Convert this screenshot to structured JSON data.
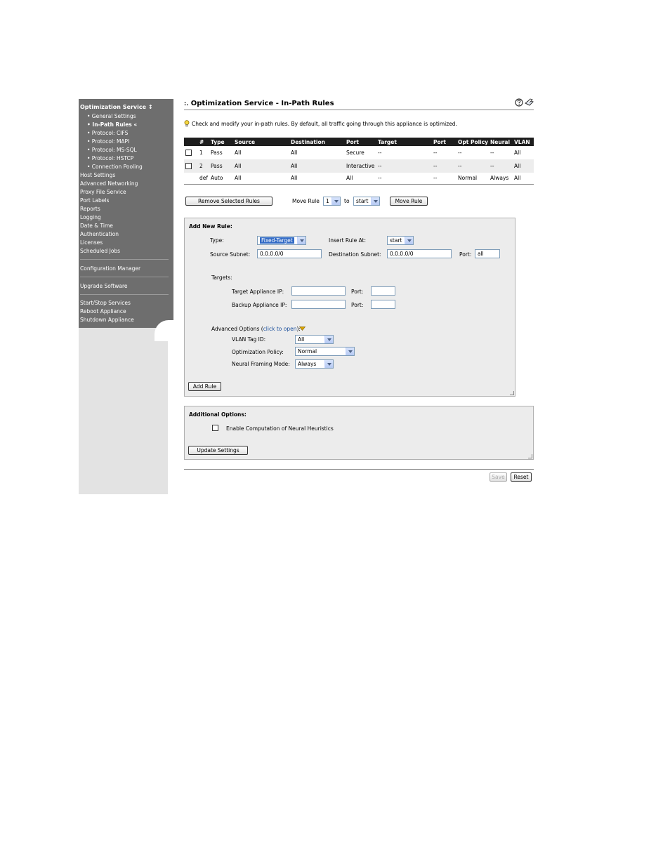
{
  "sidebar": {
    "header": "Optimization Service",
    "header_arrow": "↕",
    "sub_items": [
      {
        "label": "• General Settings",
        "current": false
      },
      {
        "label": "• In-Path Rules «",
        "current": true
      },
      {
        "label": "• Protocol: CIFS",
        "current": false
      },
      {
        "label": "• Protocol: MAPI",
        "current": false
      },
      {
        "label": "• Protocol: MS-SQL",
        "current": false
      },
      {
        "label": "• Protocol: HSTCP",
        "current": false
      },
      {
        "label": "• Connection Pooling",
        "current": false
      }
    ],
    "items": [
      "Host Settings",
      "Advanced Networking",
      "Proxy File Service",
      "Port Labels",
      "Reports",
      "Logging",
      "Date & Time",
      "Authentication",
      "Licenses",
      "Scheduled Jobs"
    ],
    "group2": [
      "Configuration Manager"
    ],
    "group3": [
      "Upgrade Software"
    ],
    "group4": [
      "Start/Stop Services",
      "Reboot Appliance",
      "Shutdown Appliance"
    ]
  },
  "header": {
    "prefix": ":.",
    "title": "Optimization Service - In-Path Rules",
    "hint": "Check and modify your in-path rules. By default, all traffic going through this appliance is optimized.",
    "icons": [
      "help-icon",
      "print-icon"
    ]
  },
  "rules_table": {
    "columns": [
      "#",
      "Type",
      "Source",
      "Destination",
      "Port",
      "Target",
      "Port",
      "Opt Policy",
      "Neural",
      "VLAN"
    ],
    "rows": [
      {
        "num": "1",
        "type": "Pass",
        "source": "All",
        "destination": "All",
        "port": "Secure",
        "target": "--",
        "target_port": "--",
        "opt_policy": "--",
        "neural": "--",
        "vlan": "All",
        "checkbox": true
      },
      {
        "num": "2",
        "type": "Pass",
        "source": "All",
        "destination": "All",
        "port": "Interactive",
        "target": "--",
        "target_port": "--",
        "opt_policy": "--",
        "neural": "--",
        "vlan": "All",
        "checkbox": true
      },
      {
        "num": "def",
        "type": "Auto",
        "source": "All",
        "destination": "All",
        "port": "All",
        "target": "--",
        "target_port": "--",
        "opt_policy": "Normal",
        "neural": "Always",
        "vlan": "All",
        "checkbox": false
      }
    ]
  },
  "controls": {
    "remove_button": "Remove Selected Rules",
    "move_rule_label": "Move Rule",
    "move_rule_value": "1",
    "to_label": "to",
    "to_value": "start",
    "move_button": "Move Rule"
  },
  "add_rule": {
    "heading": "Add New Rule:",
    "type_label": "Type:",
    "type_value": "Fixed-Target",
    "insert_label": "Insert Rule At:",
    "insert_value": "start",
    "source_label": "Source Subnet:",
    "source_value": "0.0.0.0/0",
    "dest_label": "Destination Subnet:",
    "dest_value": "0.0.0.0/0",
    "port_label": "Port:",
    "port_value": "all",
    "targets_label": "Targets:",
    "target_ip_label": "Target Appliance IP:",
    "target_port_label": "Port:",
    "backup_ip_label": "Backup Appliance IP:",
    "backup_port_label": "Port:",
    "advanced_label": "Advanced Options (",
    "advanced_link": "click to open",
    "advanced_close": "):",
    "vlan_label": "VLAN Tag ID:",
    "vlan_value": "All",
    "opt_policy_label": "Optimization Policy:",
    "opt_policy_value": "Normal",
    "neural_label": "Neural Framing Mode:",
    "neural_value": "Always",
    "add_button": "Add Rule"
  },
  "additional": {
    "heading": "Additional Options:",
    "checkbox_label": "Enable Computation of Neural Heuristics",
    "update_button": "Update Settings"
  },
  "footer": {
    "save_button": "Save",
    "reset_button": "Reset"
  },
  "colors": {
    "sidebar_bg": "#6e6e6e",
    "table_header_bg": "#1e1e1e",
    "panel_bg": "#ececec",
    "link": "#1a4f9c"
  }
}
